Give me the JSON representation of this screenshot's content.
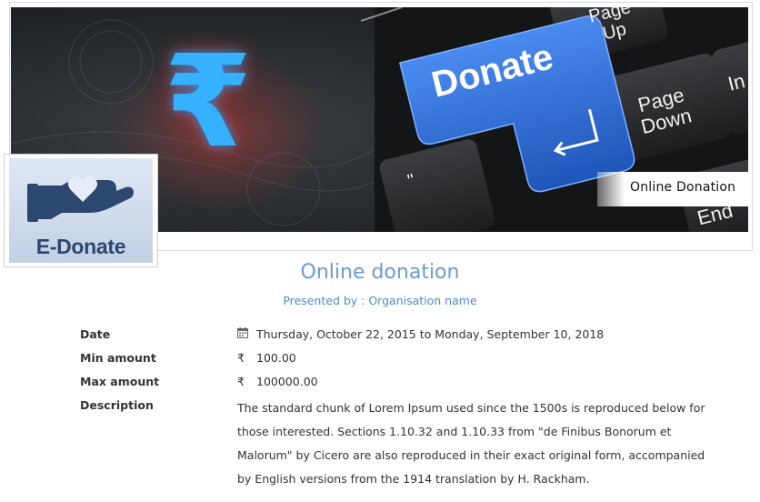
{
  "banner": {
    "donate_key": "Donate",
    "page_up_key_line1": "Page",
    "page_up_key_line2": "Up",
    "page_down_key_line1": "Page",
    "page_down_key_line2": "Down",
    "end_key": "End",
    "insert_key_fragment": "In",
    "quote_key": "\"",
    "rupee_symbol": "₹",
    "tag": "Online Donation"
  },
  "logo": {
    "text": "E-Donate",
    "icon": "hand-heart-icon"
  },
  "event": {
    "title": "Online donation",
    "presented_by": "Presented by : Organisation name"
  },
  "details": {
    "date_label": "Date",
    "date_icon": "calendar-icon",
    "date_value": "Thursday, October 22, 2015 to Monday, September 10, 2018",
    "min_label": "Min amount",
    "min_currency": "₹",
    "min_value": "100.00",
    "max_label": "Max amount",
    "max_currency": "₹",
    "max_value": "100000.00",
    "description_label": "Description",
    "description_lines": [
      "The standard chunk of Lorem Ipsum used since the 1500s is reproduced below for",
      "those interested. Sections 1.10.32 and 1.10.33 from \"de Finibus Bonorum et",
      "Malorum\" by Cicero are also reproduced in their exact original form, accompanied",
      "by English versions from the 1914 translation by H. Rackham."
    ]
  },
  "colors": {
    "title": "#6a9ad2",
    "link": "#4a8ad0",
    "donate_key": "#2f6fd8",
    "rupee_glow": "#3ab3ff",
    "logo_navy": "#2c4770"
  }
}
